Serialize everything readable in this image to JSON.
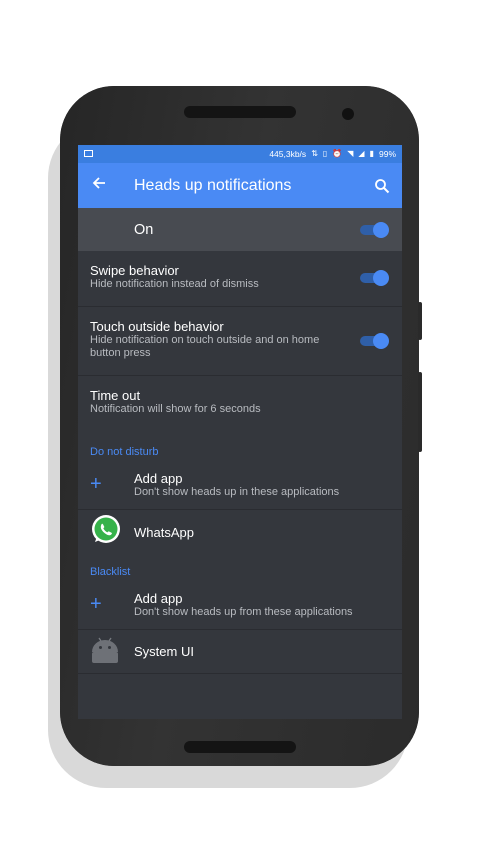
{
  "statusbar": {
    "speed": "445,3kb/s",
    "battery": "99%"
  },
  "appbar": {
    "title": "Heads up notifications"
  },
  "master": {
    "label": "On",
    "enabled": true
  },
  "prefs": [
    {
      "title": "Swipe behavior",
      "summary": "Hide notification instead of dismiss",
      "enabled": true
    },
    {
      "title": "Touch outside behavior",
      "summary": "Hide notification on touch outside and on home button press",
      "enabled": true
    },
    {
      "title": "Time out",
      "summary": "Notification will show for 6 seconds"
    }
  ],
  "dnd": {
    "header": "Do not disturb",
    "add_title": "Add app",
    "add_summary": "Don't show heads up in these applications",
    "apps": [
      {
        "name": "WhatsApp",
        "icon": "whatsapp-icon"
      }
    ]
  },
  "blacklist": {
    "header": "Blacklist",
    "add_title": "Add app",
    "add_summary": "Don't show heads up from these applications",
    "apps": [
      {
        "name": "System UI",
        "icon": "android-icon"
      }
    ]
  },
  "colors": {
    "accent": "#4a8af4",
    "statusbar": "#3a7ee0",
    "background": "#34373d"
  }
}
